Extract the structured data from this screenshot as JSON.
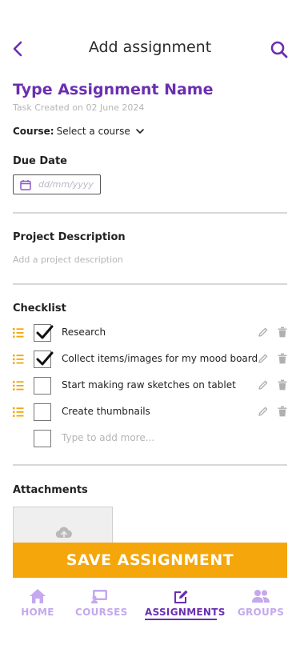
{
  "header": {
    "title": "Add assignment",
    "back_icon": "chevron-left-icon",
    "search_icon": "search-icon"
  },
  "assignment": {
    "name": "Type Assignment Name",
    "created": "Task Created on 02 June 2024",
    "course_label": "Course:",
    "course_value": "Select a course"
  },
  "due_date": {
    "label": "Due Date",
    "placeholder": "dd/mm/yyyy"
  },
  "description": {
    "label": "Project Description",
    "placeholder": "Add a project description"
  },
  "checklist": {
    "label": "Checklist",
    "items": [
      {
        "text": "Research",
        "checked": true
      },
      {
        "text": "Collect items/images for my mood board",
        "checked": true
      },
      {
        "text": "Start making raw sketches on tablet",
        "checked": false
      },
      {
        "text": "Create thumbnails",
        "checked": false
      }
    ],
    "add_placeholder": "Type to add more..."
  },
  "attachments": {
    "label": "Attachments",
    "upload_icon": "cloud-upload-icon"
  },
  "save_button": "SAVE ASSIGNMENT",
  "nav": {
    "items": [
      {
        "label": "HOME",
        "icon": "home-icon"
      },
      {
        "label": "COURSES",
        "icon": "courses-icon"
      },
      {
        "label": "ASSIGNMENTS",
        "icon": "edit-icon",
        "active": true
      },
      {
        "label": "GROUPS",
        "icon": "groups-icon"
      }
    ]
  },
  "colors": {
    "accent": "#6a2fb1",
    "nav_inactive": "#c4a9ee",
    "save": "#f4a60a",
    "drag_handle": "#f4a60a",
    "muted": "#b5b5b5"
  }
}
